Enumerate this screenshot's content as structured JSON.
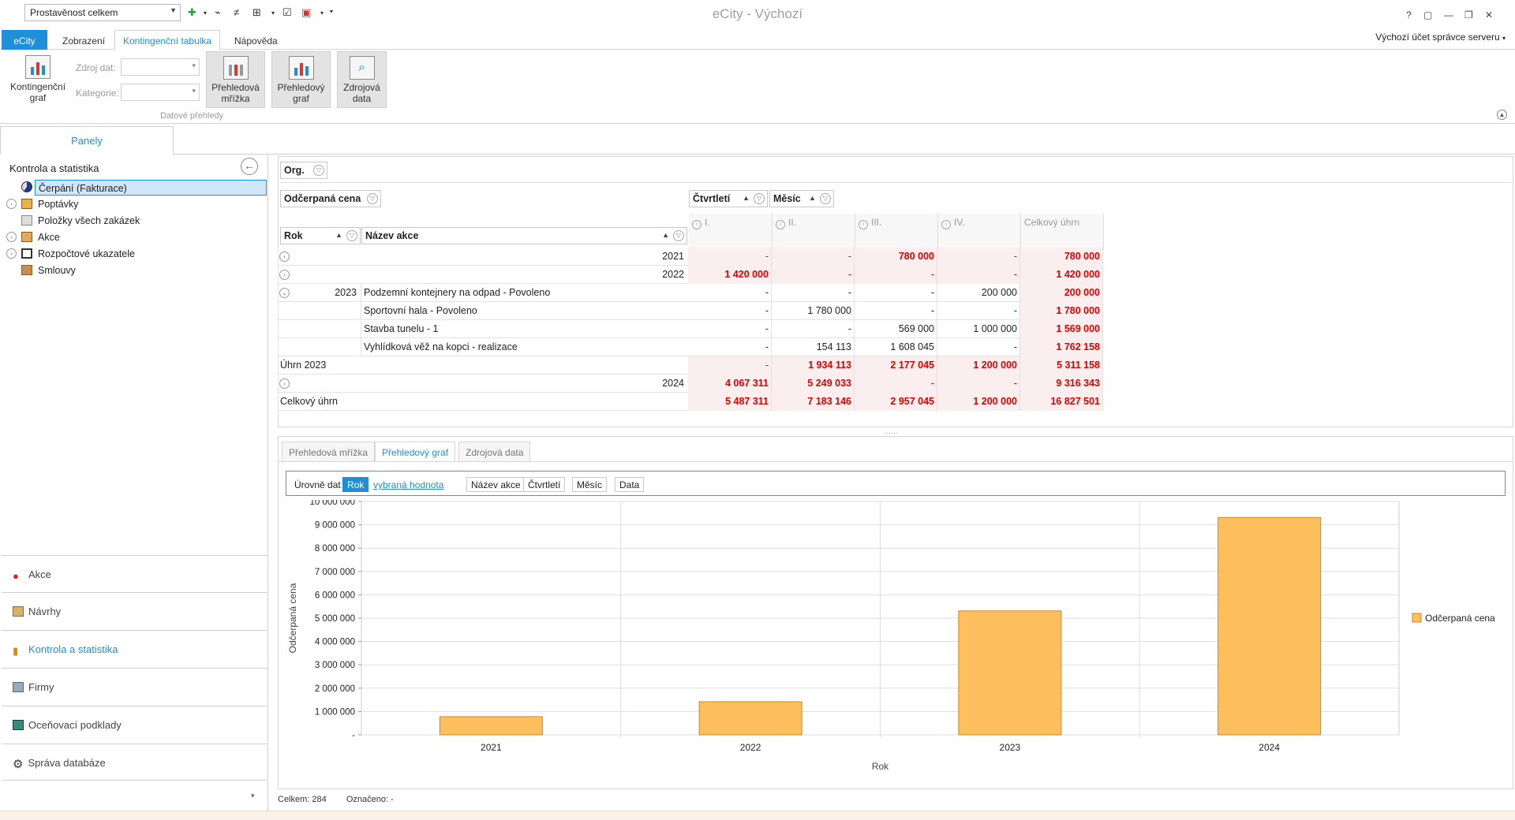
{
  "title_bar": {
    "view_selector": "Prostavěnost celkem",
    "app_title": "eCity - Výchozí",
    "window_buttons": [
      "?",
      "▢",
      "—",
      "❐",
      "✕"
    ]
  },
  "ribbon_tabs": [
    "eCity",
    "Zobrazení",
    "Kontingenční tabulka",
    "Nápověda"
  ],
  "account": "Výchozí účet správce serveru",
  "ribbon": {
    "pivot_chart": "Kontingenční graf",
    "source_label": "Zdroj dat:",
    "category_label": "Kategorie:",
    "overview_grid": "Přehledová mřížka",
    "overview_chart": "Přehledový graf",
    "source_data": "Zdrojová data",
    "group_label": "Datové přehledy"
  },
  "panels_tab": "Panely",
  "tree": {
    "title": "Kontrola a statistika",
    "items": [
      {
        "label": "Čerpání (Fakturace)",
        "icon": "pie-chart-icon"
      },
      {
        "label": "Poptávky",
        "icon": "folder-list-icon"
      },
      {
        "label": "Položky všech zakázek",
        "icon": "list-icon"
      },
      {
        "label": "Akce",
        "icon": "house-icon"
      },
      {
        "label": "Rozpočtové ukazatele",
        "icon": "target-icon"
      },
      {
        "label": "Smlouvy",
        "icon": "person-icon"
      }
    ]
  },
  "nav": [
    {
      "label": "Akce",
      "icon": "pin-icon"
    },
    {
      "label": "Návrhy",
      "icon": "cube-icon"
    },
    {
      "label": "Kontrola a statistika",
      "icon": "bars-icon"
    },
    {
      "label": "Firmy",
      "icon": "building-icon"
    },
    {
      "label": "Oceňovací podklady",
      "icon": "book-icon"
    },
    {
      "label": "Správa databáze",
      "icon": "gear-icon"
    }
  ],
  "pivot": {
    "filter_field": "Org.",
    "data_field": "Odčerpaná cena",
    "col_fields": [
      "Čtvrtletí",
      "Měsíc"
    ],
    "row_fields": [
      "Rok",
      "Název akce"
    ],
    "col_headers": [
      "I.",
      "II.",
      "III.",
      "IV.",
      "Celkový úhrn"
    ],
    "rows": [
      {
        "year": "2021",
        "name": "",
        "vals": [
          "-",
          "-",
          "780 000",
          "-",
          "780 000"
        ],
        "kind": "collapsed"
      },
      {
        "year": "2022",
        "name": "",
        "vals": [
          "1 420 000",
          "-",
          "-",
          "-",
          "1 420 000"
        ],
        "kind": "collapsed"
      },
      {
        "year": "2023",
        "name": "Podzemní kontejnery na odpad - Povoleno",
        "vals": [
          "-",
          "-",
          "-",
          "200 000",
          "200 000"
        ],
        "kind": "detail"
      },
      {
        "year": "",
        "name": "Sportovní hala - Povoleno",
        "vals": [
          "-",
          "1 780 000",
          "-",
          "-",
          "1 780 000"
        ],
        "kind": "detail"
      },
      {
        "year": "",
        "name": "Stavba tunelu - 1",
        "vals": [
          "-",
          "-",
          "569 000",
          "1 000 000",
          "1 569 000"
        ],
        "kind": "detail"
      },
      {
        "year": "",
        "name": "Vyhlídková věž na kopci - realizace",
        "vals": [
          "-",
          "154 113",
          "1 608 045",
          "-",
          "1 762 158"
        ],
        "kind": "detail"
      },
      {
        "year": "Úhrn 2023",
        "name": "",
        "vals": [
          "-",
          "1 934 113",
          "2 177 045",
          "1 200 000",
          "5 311 158"
        ],
        "kind": "subtotal"
      },
      {
        "year": "2024",
        "name": "",
        "vals": [
          "4 067 311",
          "5 249 033",
          "-",
          "-",
          "9 316 343"
        ],
        "kind": "collapsed"
      },
      {
        "year": "Celkový úhrn",
        "name": "",
        "vals": [
          "5 487 311",
          "7 183 146",
          "2 957 045",
          "1 200 000",
          "16 827 501"
        ],
        "kind": "total"
      }
    ]
  },
  "chart_tabs": [
    "Přehledová mřížka",
    "Přehledový graf",
    "Zdrojová data"
  ],
  "levels": {
    "label": "Úrovně dat",
    "items": [
      "Rok",
      "vybraná hodnota",
      "Název akce",
      "Čtvrtletí",
      "Měsíc",
      "Data"
    ]
  },
  "chart_data": {
    "type": "bar",
    "categories": [
      "2021",
      "2022",
      "2023",
      "2024"
    ],
    "series": [
      {
        "name": "Odčerpaná cena",
        "values": [
          780000,
          1420000,
          5311158,
          9316343
        ]
      }
    ],
    "xlabel": "Rok",
    "ylabel": "Odčerpaná cena",
    "ylim": [
      0,
      10000000
    ],
    "y_ticks": [
      "-",
      "1 000 000",
      "2 000 000",
      "3 000 000",
      "4 000 000",
      "5 000 000",
      "6 000 000",
      "7 000 000",
      "8 000 000",
      "9 000 000",
      "10 000 000"
    ],
    "legend": "right",
    "grid": true,
    "color": "#fdbf5e"
  },
  "status": {
    "total": "Celkem: 284",
    "marked": "Označeno: -"
  }
}
